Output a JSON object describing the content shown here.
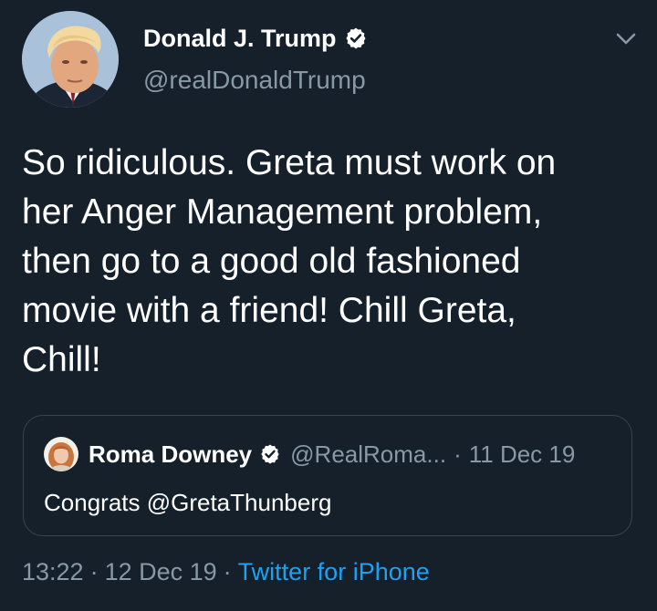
{
  "author": {
    "display_name": "Donald J. Trump",
    "handle": "@realDonaldTrump",
    "verified": true,
    "avatar_icon": "profile-photo"
  },
  "menu_icon": "chevron-down-icon",
  "tweet": {
    "text": "So ridiculous. Greta must work on\nher Anger Management problem,\nthen go to a good old fashioned\nmovie with a friend! Chill Greta,\nChill!"
  },
  "quoted_tweet": {
    "display_name": "Roma Downey",
    "handle": "@RealRoma...",
    "separator": "·",
    "date": "11 Dec 19",
    "text": "Congrats @GretaThunberg",
    "verified": true
  },
  "meta": {
    "time": "13:22",
    "separator": "·",
    "date": "12 Dec 19",
    "source": "Twitter for iPhone"
  },
  "colors": {
    "background": "#15202b",
    "primary_text": "#ffffff",
    "secondary_text": "#8899a6",
    "link": "#1da1f2",
    "border": "#38444d"
  }
}
